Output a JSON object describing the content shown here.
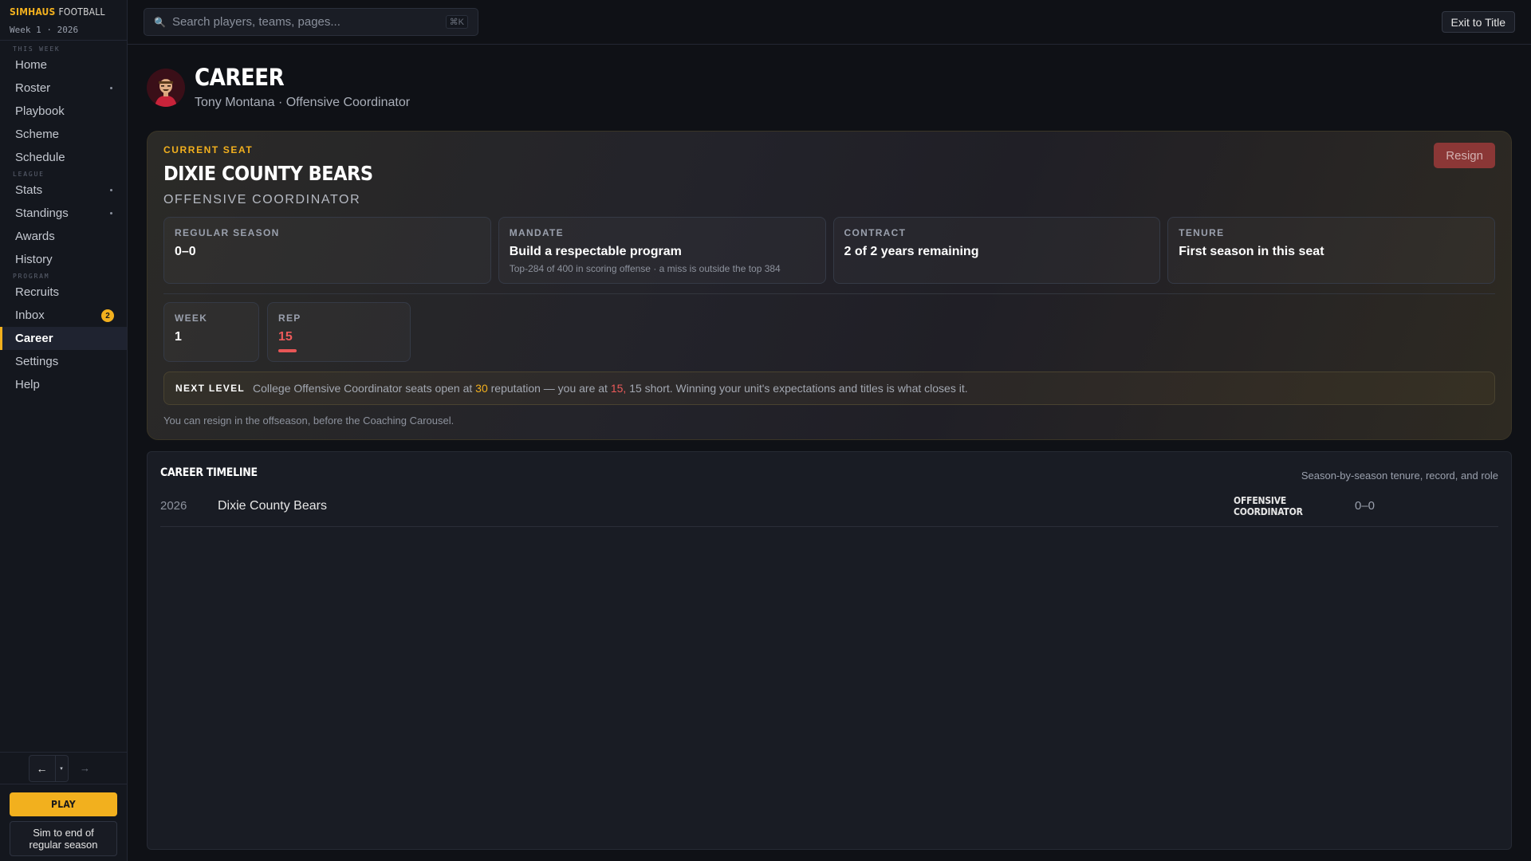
{
  "brand": {
    "title_a": "SIMHAUS",
    "title_b": "FOOTBALL",
    "week": "Week 1 · 2026"
  },
  "nav": {
    "section_this_week": "THIS WEEK",
    "section_league": "LEAGUE",
    "section_program": "PROGRAM",
    "home": "Home",
    "roster": "Roster",
    "playbook": "Playbook",
    "scheme": "Scheme",
    "schedule": "Schedule",
    "stats": "Stats",
    "standings": "Standings",
    "awards": "Awards",
    "history": "History",
    "recruits": "Recruits",
    "inbox": "Inbox",
    "inbox_badge": "2",
    "career": "Career",
    "settings": "Settings",
    "help": "Help"
  },
  "history_nav": {
    "back": "←",
    "drop": "▾",
    "forward": "→"
  },
  "sim": {
    "play": "PLAY",
    "sim_end": "Sim to end of regular season"
  },
  "search": {
    "placeholder": "Search players, teams, pages...",
    "shortcut": "⌘K"
  },
  "topbar": {
    "exit": "Exit to Title"
  },
  "header": {
    "title": "CAREER",
    "subtitle": "Tony Montana · Offensive Coordinator"
  },
  "seat": {
    "label": "CURRENT SEAT",
    "team": "DIXIE COUNTY BEARS",
    "role": "OFFENSIVE COORDINATOR",
    "resign": "Resign",
    "stats": [
      {
        "label": "REGULAR SEASON",
        "value": "0–0",
        "note": ""
      },
      {
        "label": "MANDATE",
        "value": "Build a respectable program",
        "note": "Top-284 of 400 in scoring offense · a miss is outside the top 384"
      },
      {
        "label": "CONTRACT",
        "value": "2 of 2 years remaining",
        "note": ""
      },
      {
        "label": "TENURE",
        "value": "First season in this seat",
        "note": ""
      }
    ],
    "week_label": "WEEK",
    "week_value": "1",
    "rep_label": "REP",
    "rep_value": "15",
    "rep_fraction": 0.5,
    "next_level": {
      "tag": "NEXT LEVEL",
      "t1": "College Offensive Coordinator seats open at",
      "threshold": "30",
      "t2": "reputation — you are at",
      "current": "15,",
      "t3": "15 short. Winning your unit's expectations and titles is what closes it."
    },
    "resign_note": "You can resign in the offseason, before the Coaching Carousel."
  },
  "timeline": {
    "title": "CAREER TIMELINE",
    "subtitle": "Season-by-season tenure, record, and role",
    "rows": [
      {
        "year": "2026",
        "team": "Dixie County Bears",
        "role": "OFFENSIVE COORDINATOR",
        "record": "0–0"
      }
    ]
  },
  "colors": {
    "accent": "#f2b01e",
    "danger": "#ec5a5a",
    "background": "#0f1116"
  }
}
